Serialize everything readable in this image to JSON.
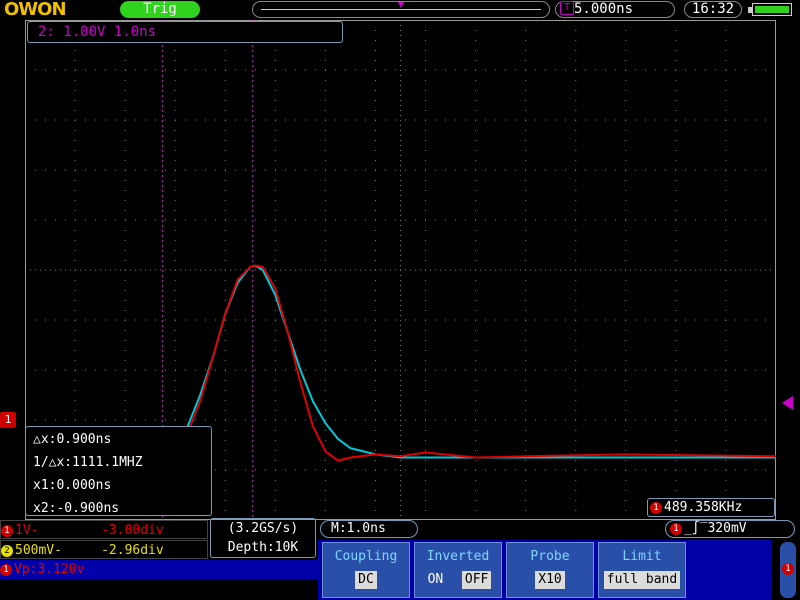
{
  "topbar": {
    "logo": "OWON",
    "trig_label": "Trig",
    "timebase": "5.000ns",
    "timebase_icon_label": "T",
    "clock": "16:32"
  },
  "zoom_info": "2: 1.00V 1.0ns",
  "channel_marker": "1",
  "cursor_readout": {
    "dx": "△x:0.900ns",
    "inv_dx": "1/△x:1111.1MHZ",
    "x1": "x1:0.000ns",
    "x2": "x2:-0.900ns"
  },
  "freq": {
    "badge": "1",
    "value": "489.358KHz"
  },
  "ch1": {
    "badge": "1",
    "text": "1V-        -3.00div"
  },
  "ch2": {
    "badge": "2",
    "text": "500mV-     -2.96div"
  },
  "measure": {
    "badge": "1",
    "text": "Vp:3.120v"
  },
  "acquisition": {
    "rate": "(3.2GS/s)",
    "depth": "Depth:10K"
  },
  "menu_title": "M:1.0ns",
  "trigger": {
    "badge": "1",
    "text": "_∫‾320mV"
  },
  "menu": [
    {
      "title": "Coupling",
      "values": [
        "DC"
      ]
    },
    {
      "title": "Inverted",
      "values": [
        "ON",
        "OFF"
      ]
    },
    {
      "title": "Probe",
      "values": [
        "X10"
      ]
    },
    {
      "title": "Limit",
      "values": [
        "full band"
      ]
    }
  ],
  "scroll_badge": "1",
  "colors": {
    "ch1": "#e00000",
    "ch2": "#00c8d8",
    "cursor": "#cc33cc",
    "grid": "#7a7a7a",
    "trig_green": "#2fd31d",
    "menu_blue": "#0000a8"
  },
  "chart_data": {
    "type": "line",
    "title": "",
    "xlabel": "",
    "ylabel": "",
    "grid": true,
    "x_unit": "ns",
    "y_unit": "div",
    "xlim": [
      -10,
      20
    ],
    "ylim": [
      -4,
      4
    ],
    "series": [
      {
        "name": "",
        "x": [
          -10,
          -6,
          -5,
          -4.5,
          -4,
          -3.5,
          -3,
          -2.5,
          -2,
          -1.5,
          -1,
          -0.8,
          -0.5,
          0,
          0.5,
          1,
          1.5,
          2,
          2.5,
          3,
          4,
          5,
          6,
          8,
          10,
          14,
          20
        ],
        "y": [
          -3.0,
          -3.0,
          -3.0,
          -2.95,
          -2.8,
          -2.5,
          -2.0,
          -1.4,
          -0.7,
          -0.2,
          0.05,
          0.07,
          0.0,
          -0.4,
          -1.0,
          -1.6,
          -2.1,
          -2.45,
          -2.7,
          -2.85,
          -2.95,
          -3.0,
          -3.0,
          -3.0,
          -3.0,
          -3.0,
          -3.0
        ]
      },
      {
        "name": "",
        "x": [
          -10,
          -6,
          -5,
          -4.5,
          -4,
          -3.5,
          -3,
          -2.5,
          -2,
          -1.5,
          -1,
          -0.8,
          -0.5,
          0,
          0.5,
          1,
          1.5,
          2,
          2.5,
          3,
          4,
          5,
          6,
          8,
          10,
          14,
          20
        ],
        "y": [
          -2.98,
          -2.98,
          -2.98,
          -2.95,
          -2.85,
          -2.6,
          -2.1,
          -1.4,
          -0.7,
          -0.15,
          0.05,
          0.07,
          0.05,
          -0.3,
          -1.0,
          -1.8,
          -2.5,
          -2.9,
          -3.05,
          -3.0,
          -2.95,
          -2.98,
          -2.92,
          -3.0,
          -2.98,
          -2.95,
          -2.98
        ]
      }
    ],
    "cursors_x": [
      -4.5,
      -0.9
    ]
  }
}
